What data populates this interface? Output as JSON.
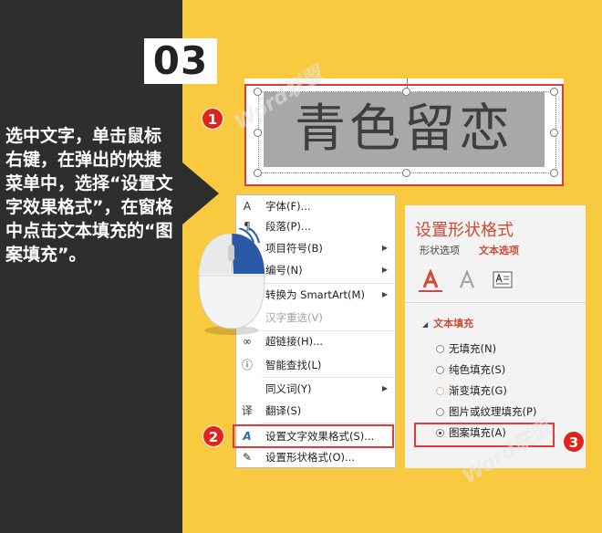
{
  "step": {
    "number": "03"
  },
  "instruction": "选中文字，单击鼠标右键，在弹出的快捷菜单中，选择“设置文字效果格式”，在窗格中点击文本填充的“图案填充”。",
  "slide": {
    "text": "青色留恋"
  },
  "badges": [
    "1",
    "2",
    "3"
  ],
  "watermark": {
    "en": "Word",
    "cn": "联盟"
  },
  "context_menu": {
    "items": [
      {
        "icon": "A",
        "label": "字体(F)..."
      },
      {
        "icon": "¶",
        "label": "段落(P)..."
      },
      {
        "icon": "☰",
        "label": "项目符号(B)"
      },
      {
        "icon": "☷",
        "label": "编号(N)"
      },
      {
        "icon": "▦",
        "label": "转换为 SmartArt(M)"
      },
      {
        "icon": "",
        "label": "汉字重选(V)"
      },
      {
        "icon": "∞",
        "label": "超链接(H)..."
      },
      {
        "icon": "ⓘ",
        "label": "智能查找(L)"
      },
      {
        "icon": "",
        "label": "同义词(Y)"
      },
      {
        "icon": "译",
        "label": "翻译(S)"
      },
      {
        "icon": "A",
        "label": "设置文字效果格式(S)..."
      },
      {
        "icon": "✎",
        "label": "设置形状格式(O)..."
      }
    ],
    "submenu_arrow": "▶"
  },
  "panel": {
    "title": "设置形状格式",
    "tabs": [
      "形状选项",
      "文本选项"
    ],
    "section": {
      "toggle": "◢",
      "label": "文本填充"
    },
    "options": [
      "无填充(N)",
      "纯色填充(S)",
      "渐变填充(G)",
      "图片或纹理填充(P)",
      "图案填充(A)"
    ],
    "selected_option": "图案填充(A)"
  },
  "colors": {
    "dark": "#2e2e2e",
    "yellow": "#f9c93f",
    "accent_red": "#e03b3b",
    "panel_red": "#d04a36"
  }
}
